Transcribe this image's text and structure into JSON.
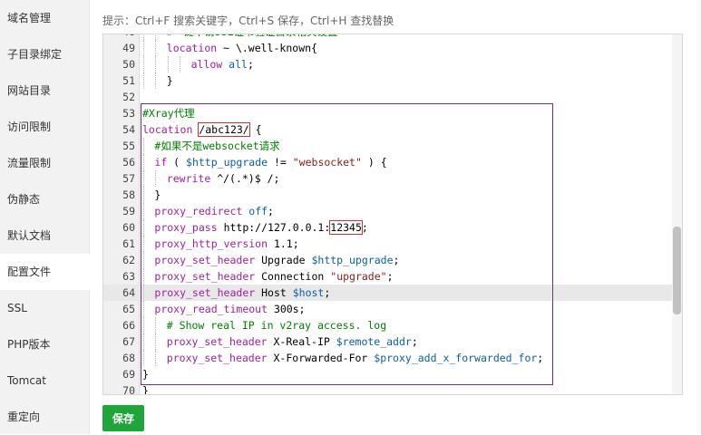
{
  "sidebar": {
    "items": [
      {
        "label": "域名管理"
      },
      {
        "label": "子目录绑定"
      },
      {
        "label": "网站目录"
      },
      {
        "label": "访问限制"
      },
      {
        "label": "流量限制"
      },
      {
        "label": "伪静态"
      },
      {
        "label": "默认文档"
      },
      {
        "label": "配置文件",
        "active": true
      },
      {
        "label": "SSL"
      },
      {
        "label": "PHP版本"
      },
      {
        "label": "Tomcat"
      },
      {
        "label": "重定向"
      }
    ]
  },
  "hint": "提示：Ctrl+F 搜索关键字，Ctrl+S 保存，Ctrl+H 查找替换",
  "editor": {
    "lines": [
      {
        "n": "48",
        "indent": 2,
        "tokens": [
          [
            "c",
            "#一键申请SSL证书验证目录相关设置"
          ]
        ]
      },
      {
        "n": "49",
        "indent": 2,
        "tokens": [
          [
            "p",
            "location"
          ],
          [
            "d",
            " ~ \\.well-known{"
          ]
        ]
      },
      {
        "n": "50",
        "indent": 4,
        "tokens": [
          [
            "p",
            "allow"
          ],
          [
            "d",
            " "
          ],
          [
            "v",
            "all"
          ],
          [
            "d",
            ";"
          ]
        ]
      },
      {
        "n": "51",
        "indent": 2,
        "tokens": [
          [
            "d",
            "}"
          ]
        ]
      },
      {
        "n": "52",
        "indent": 0,
        "tokens": []
      },
      {
        "n": "53",
        "indent": 0,
        "tokens": [
          [
            "c",
            "#Xray代理"
          ]
        ]
      },
      {
        "n": "54",
        "indent": 0,
        "tokens": [
          [
            "p",
            "location"
          ],
          [
            "d",
            " "
          ],
          [
            "box",
            "/abc123/"
          ],
          [
            "d",
            " {"
          ]
        ]
      },
      {
        "n": "55",
        "indent": 1,
        "tokens": [
          [
            "c",
            "#如果不是websocket请求"
          ]
        ]
      },
      {
        "n": "56",
        "indent": 1,
        "tokens": [
          [
            "p",
            "if"
          ],
          [
            "d",
            " ( "
          ],
          [
            "v",
            "$http_upgrade"
          ],
          [
            "d",
            " != "
          ],
          [
            "s",
            "\"websocket\""
          ],
          [
            "d",
            " ) {"
          ]
        ]
      },
      {
        "n": "57",
        "indent": 2,
        "tokens": [
          [
            "p",
            "rewrite"
          ],
          [
            "d",
            " ^/(.*)$ /;"
          ]
        ]
      },
      {
        "n": "58",
        "indent": 1,
        "tokens": [
          [
            "d",
            "}"
          ]
        ]
      },
      {
        "n": "59",
        "indent": 1,
        "tokens": [
          [
            "p",
            "proxy_redirect"
          ],
          [
            "d",
            " "
          ],
          [
            "v",
            "off"
          ],
          [
            "d",
            ";"
          ]
        ]
      },
      {
        "n": "60",
        "indent": 1,
        "tokens": [
          [
            "p",
            "proxy_pass"
          ],
          [
            "d",
            " http://127.0.0.1:"
          ],
          [
            "box",
            "12345"
          ],
          [
            "d",
            ";"
          ]
        ]
      },
      {
        "n": "61",
        "indent": 1,
        "tokens": [
          [
            "p",
            "proxy_http_version"
          ],
          [
            "d",
            " 1.1;"
          ]
        ]
      },
      {
        "n": "62",
        "indent": 1,
        "tokens": [
          [
            "p",
            "proxy_set_header"
          ],
          [
            "d",
            " Upgrade "
          ],
          [
            "v",
            "$http_upgrade"
          ],
          [
            "d",
            ";"
          ]
        ]
      },
      {
        "n": "63",
        "indent": 1,
        "tokens": [
          [
            "p",
            "proxy_set_header"
          ],
          [
            "d",
            " Connection "
          ],
          [
            "s",
            "\"upgrade\""
          ],
          [
            "d",
            ";"
          ]
        ]
      },
      {
        "n": "64",
        "indent": 1,
        "highlight": true,
        "tokens": [
          [
            "p",
            "proxy_set_header"
          ],
          [
            "d",
            " Host "
          ],
          [
            "v",
            "$host"
          ],
          [
            "d",
            ";"
          ]
        ]
      },
      {
        "n": "65",
        "indent": 1,
        "tokens": [
          [
            "p",
            "proxy_read_timeout"
          ],
          [
            "d",
            " 300s;"
          ]
        ]
      },
      {
        "n": "66",
        "indent": 2,
        "tokens": [
          [
            "c",
            "# Show real IP in v2ray access. log"
          ]
        ]
      },
      {
        "n": "67",
        "indent": 2,
        "tokens": [
          [
            "p",
            "proxy_set_header"
          ],
          [
            "d",
            " X-Real-IP "
          ],
          [
            "v",
            "$remote_addr"
          ],
          [
            "d",
            ";"
          ]
        ]
      },
      {
        "n": "68",
        "indent": 2,
        "tokens": [
          [
            "p",
            "proxy_set_header"
          ],
          [
            "d",
            " X-Forwarded-For "
          ],
          [
            "v",
            "$proxy_add_x_forwarded_for"
          ],
          [
            "d",
            ";"
          ]
        ]
      },
      {
        "n": "69",
        "indent": 0,
        "tokens": [
          [
            "d",
            "}"
          ]
        ]
      },
      {
        "n": "70",
        "indent": 0,
        "tokens": [
          [
            "d",
            "}"
          ]
        ]
      }
    ]
  },
  "save_label": "保存",
  "colors": {
    "accent": "#20a53a",
    "highlight_box": "#d43030",
    "frame": "#7b2c80"
  }
}
